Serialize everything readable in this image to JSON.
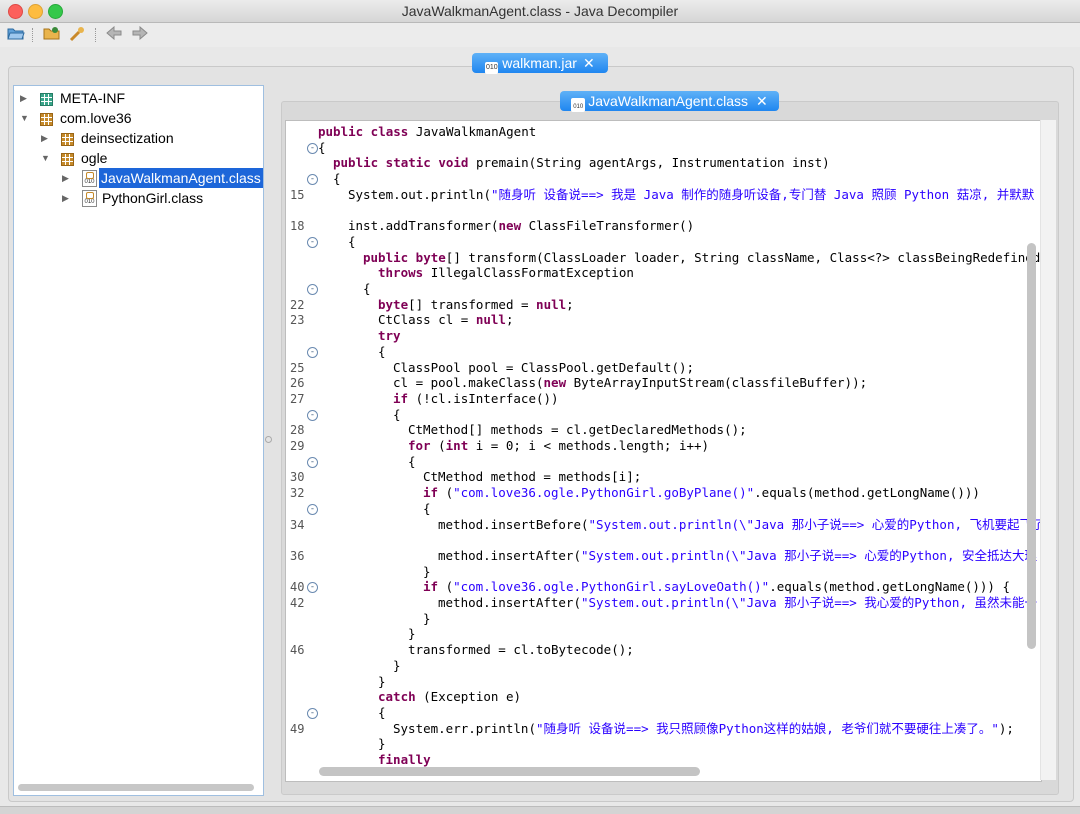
{
  "window": {
    "title": "JavaWalkmanAgent.class - Java Decompiler"
  },
  "toolbar": {
    "icons": [
      "open-file-icon",
      "open-type-icon",
      "search-icon",
      "back-icon",
      "forward-icon"
    ]
  },
  "tabs": {
    "jar": {
      "label": "walkman.jar",
      "close": "✕",
      "icon_text": "010"
    },
    "class": {
      "label": "JavaWalkmanAgent.class",
      "close": "✕",
      "icon_text": "010"
    }
  },
  "tree": {
    "items": [
      {
        "label": "META-INF",
        "arrow": "▶",
        "icon": "package-icon"
      },
      {
        "label": "com.love36",
        "arrow": "▼",
        "icon": "package-icon"
      },
      {
        "label": "deinsectization",
        "arrow": "▶",
        "icon": "package-icon"
      },
      {
        "label": "ogle",
        "arrow": "▼",
        "icon": "package-icon"
      },
      {
        "label": "JavaWalkmanAgent.class",
        "arrow": "▶",
        "icon": "class-file-icon",
        "selected": true
      },
      {
        "label": "PythonGirl.class",
        "arrow": "▶",
        "icon": "class-file-icon"
      }
    ]
  },
  "code": {
    "lines": [
      {
        "ln": "",
        "fold": "",
        "indent": 0,
        "parts": [
          [
            "kw",
            "public class "
          ],
          [
            "t",
            "JavaWalkmanAgent"
          ]
        ]
      },
      {
        "ln": "",
        "fold": "⊖",
        "indent": 0,
        "parts": [
          [
            "t",
            "{"
          ]
        ]
      },
      {
        "ln": "",
        "fold": "",
        "indent": 2,
        "parts": [
          [
            "kw",
            "public static void "
          ],
          [
            "t",
            "premain(String agentArgs, Instrumentation inst)"
          ]
        ]
      },
      {
        "ln": "",
        "fold": "⊖",
        "indent": 2,
        "parts": [
          [
            "t",
            "{"
          ]
        ]
      },
      {
        "ln": "15",
        "fold": "",
        "indent": 4,
        "parts": [
          [
            "t",
            "System.out.println("
          ],
          [
            "str",
            "\"随身听 设备说==> 我是 Java 制作的随身听设备,专门替 Java 照顾 Python 菇凉, 并默默"
          ]
        ]
      },
      {
        "ln": "",
        "fold": "",
        "indent": 0,
        "parts": []
      },
      {
        "ln": "18",
        "fold": "",
        "indent": 4,
        "parts": [
          [
            "t",
            "inst.addTransformer("
          ],
          [
            "kw",
            "new "
          ],
          [
            "t",
            "ClassFileTransformer()"
          ]
        ]
      },
      {
        "ln": "",
        "fold": "⊖",
        "indent": 4,
        "parts": [
          [
            "t",
            "{"
          ]
        ]
      },
      {
        "ln": "",
        "fold": "",
        "indent": 6,
        "parts": [
          [
            "kw",
            "public byte"
          ],
          [
            "t",
            "[] transform(ClassLoader loader, String className, Class<?> classBeingRedefined"
          ]
        ]
      },
      {
        "ln": "",
        "fold": "",
        "indent": 8,
        "parts": [
          [
            "kw",
            "throws "
          ],
          [
            "t",
            "IllegalClassFormatException"
          ]
        ]
      },
      {
        "ln": "",
        "fold": "⊖",
        "indent": 6,
        "parts": [
          [
            "t",
            "{"
          ]
        ]
      },
      {
        "ln": "22",
        "fold": "",
        "indent": 8,
        "parts": [
          [
            "kw",
            "byte"
          ],
          [
            "t",
            "[] transformed = "
          ],
          [
            "kw",
            "null"
          ],
          [
            "t",
            ";"
          ]
        ]
      },
      {
        "ln": "23",
        "fold": "",
        "indent": 8,
        "parts": [
          [
            "t",
            "CtClass cl = "
          ],
          [
            "kw",
            "null"
          ],
          [
            "t",
            ";"
          ]
        ]
      },
      {
        "ln": "",
        "fold": "",
        "indent": 8,
        "parts": [
          [
            "kw",
            "try"
          ]
        ]
      },
      {
        "ln": "",
        "fold": "⊖",
        "indent": 8,
        "parts": [
          [
            "t",
            "{"
          ]
        ]
      },
      {
        "ln": "25",
        "fold": "",
        "indent": 10,
        "parts": [
          [
            "t",
            "ClassPool pool = ClassPool.getDefault();"
          ]
        ]
      },
      {
        "ln": "26",
        "fold": "",
        "indent": 10,
        "parts": [
          [
            "t",
            "cl = pool.makeClass("
          ],
          [
            "kw",
            "new "
          ],
          [
            "t",
            "ByteArrayInputStream(classfileBuffer));"
          ]
        ]
      },
      {
        "ln": "27",
        "fold": "",
        "indent": 10,
        "parts": [
          [
            "kw",
            "if "
          ],
          [
            "t",
            "(!cl.isInterface())"
          ]
        ]
      },
      {
        "ln": "",
        "fold": "⊖",
        "indent": 10,
        "parts": [
          [
            "t",
            "{"
          ]
        ]
      },
      {
        "ln": "28",
        "fold": "",
        "indent": 12,
        "parts": [
          [
            "t",
            "CtMethod[] methods = cl.getDeclaredMethods();"
          ]
        ]
      },
      {
        "ln": "29",
        "fold": "",
        "indent": 12,
        "parts": [
          [
            "kw",
            "for "
          ],
          [
            "t",
            "("
          ],
          [
            "kw",
            "int "
          ],
          [
            "t",
            "i = 0; i < methods.length; i++)"
          ]
        ]
      },
      {
        "ln": "",
        "fold": "⊖",
        "indent": 12,
        "parts": [
          [
            "t",
            "{"
          ]
        ]
      },
      {
        "ln": "30",
        "fold": "",
        "indent": 14,
        "parts": [
          [
            "t",
            "CtMethod method = methods[i];"
          ]
        ]
      },
      {
        "ln": "32",
        "fold": "",
        "indent": 14,
        "parts": [
          [
            "kw",
            "if "
          ],
          [
            "t",
            "("
          ],
          [
            "str",
            "\"com.love36.ogle.PythonGirl.goByPlane()\""
          ],
          [
            "t",
            ".equals(method.getLongName()))"
          ]
        ]
      },
      {
        "ln": "",
        "fold": "⊖",
        "indent": 14,
        "parts": [
          [
            "t",
            "{"
          ]
        ]
      },
      {
        "ln": "34",
        "fold": "",
        "indent": 16,
        "parts": [
          [
            "t",
            "method.insertBefore("
          ],
          [
            "str",
            "\"System.out.println(\\\"Java 那小子说==> 心爱的Python, 飞机要起飞了"
          ]
        ]
      },
      {
        "ln": "",
        "fold": "",
        "indent": 0,
        "parts": []
      },
      {
        "ln": "36",
        "fold": "",
        "indent": 16,
        "parts": [
          [
            "t",
            "method.insertAfter("
          ],
          [
            "str",
            "\"System.out.println(\\\"Java 那小子说==> 心爱的Python, 安全抵达大理"
          ]
        ]
      },
      {
        "ln": "",
        "fold": "",
        "indent": 14,
        "parts": [
          [
            "t",
            "}"
          ]
        ]
      },
      {
        "ln": "40",
        "fold": "⊖",
        "indent": 14,
        "parts": [
          [
            "kw",
            "if "
          ],
          [
            "t",
            "("
          ],
          [
            "str",
            "\"com.love36.ogle.PythonGirl.sayLoveOath()\""
          ],
          [
            "t",
            ".equals(method.getLongName())) {"
          ]
        ]
      },
      {
        "ln": "42",
        "fold": "",
        "indent": 16,
        "parts": [
          [
            "t",
            "method.insertAfter("
          ],
          [
            "str",
            "\"System.out.println(\\\"Java 那小子说==> 我心爱的Python, 虽然未能一"
          ]
        ]
      },
      {
        "ln": "",
        "fold": "",
        "indent": 14,
        "parts": [
          [
            "t",
            "}"
          ]
        ]
      },
      {
        "ln": "",
        "fold": "",
        "indent": 12,
        "parts": [
          [
            "t",
            "}"
          ]
        ]
      },
      {
        "ln": "46",
        "fold": "",
        "indent": 12,
        "parts": [
          [
            "t",
            "transformed = cl.toBytecode();"
          ]
        ]
      },
      {
        "ln": "",
        "fold": "",
        "indent": 10,
        "parts": [
          [
            "t",
            "}"
          ]
        ]
      },
      {
        "ln": "",
        "fold": "",
        "indent": 8,
        "parts": [
          [
            "t",
            "}"
          ]
        ]
      },
      {
        "ln": "",
        "fold": "",
        "indent": 8,
        "parts": [
          [
            "kw",
            "catch "
          ],
          [
            "t",
            "(Exception e)"
          ]
        ]
      },
      {
        "ln": "",
        "fold": "⊖",
        "indent": 8,
        "parts": [
          [
            "t",
            "{"
          ]
        ]
      },
      {
        "ln": "49",
        "fold": "",
        "indent": 10,
        "parts": [
          [
            "t",
            "System.err.println("
          ],
          [
            "str",
            "\"随身听 设备说==> 我只照顾像Python这样的姑娘, 老爷们就不要硬往上凑了。\""
          ],
          [
            "t",
            ");"
          ]
        ]
      },
      {
        "ln": "",
        "fold": "",
        "indent": 8,
        "parts": [
          [
            "t",
            "}"
          ]
        ]
      },
      {
        "ln": "",
        "fold": "",
        "indent": 8,
        "parts": [
          [
            "kw",
            "finally"
          ]
        ]
      }
    ]
  }
}
